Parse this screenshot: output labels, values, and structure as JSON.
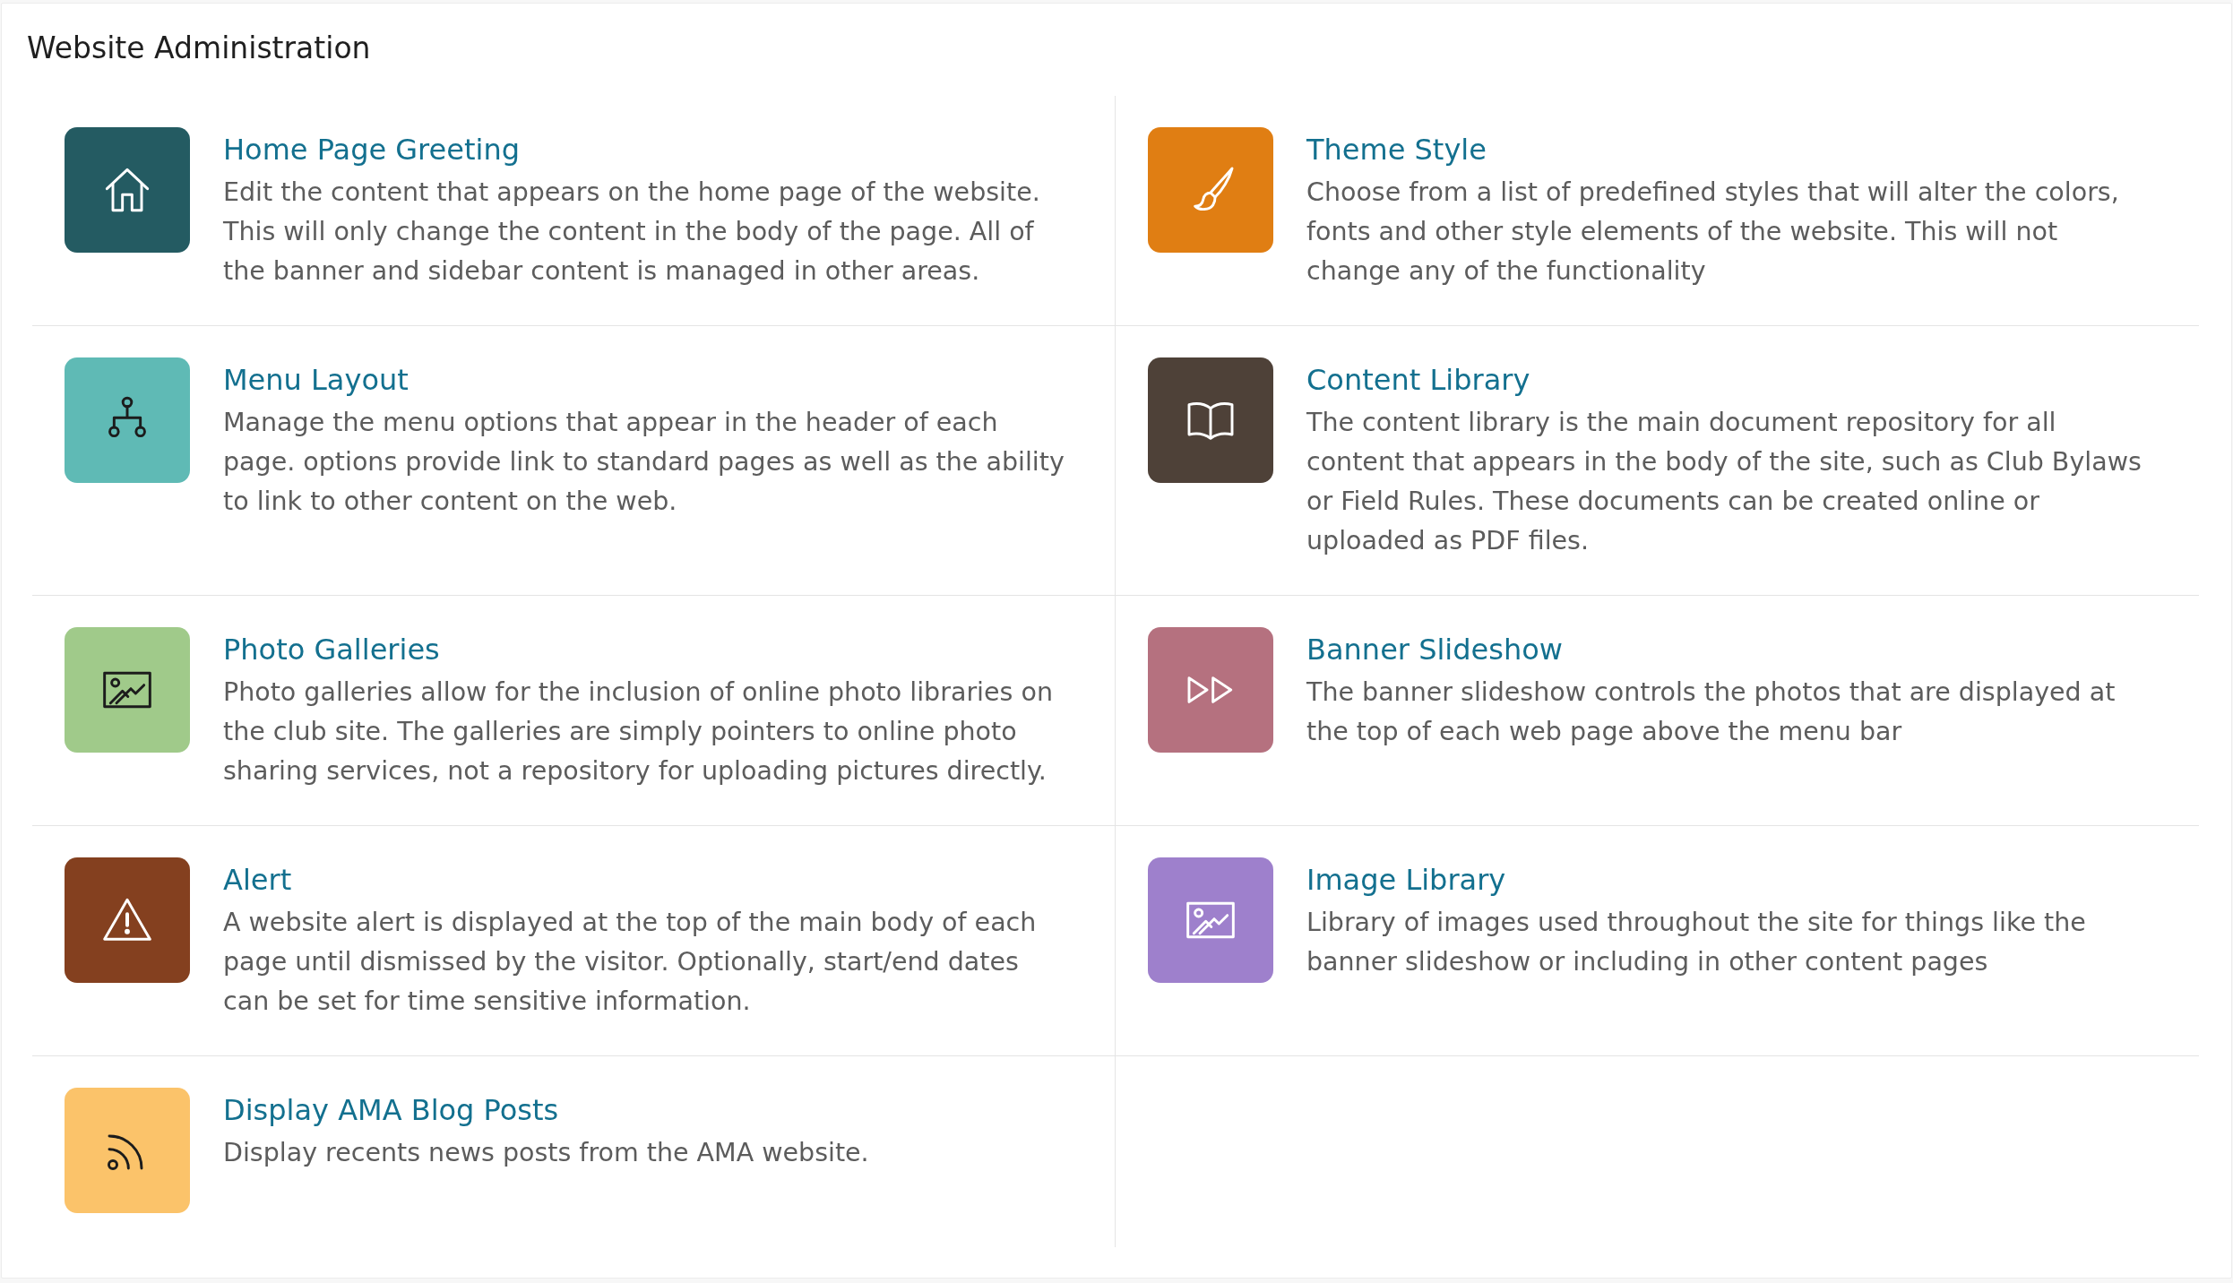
{
  "page": {
    "title": "Website Administration"
  },
  "items": [
    {
      "title": "Home Page Greeting",
      "description": "Edit the content that appears on the home page of the website. This will only change the content in the body of the page. All of the banner and sidebar content is managed in other areas.",
      "color": "#245b62"
    },
    {
      "title": "Theme Style",
      "description": "Choose from a list of predefined styles that will alter the colors, fonts and other style elements of the website. This will not change any of the functionality",
      "color": "#e07e13"
    },
    {
      "title": "Menu Layout",
      "description": "Manage the menu options that appear in the header of each page. options provide link to standard pages as well as the ability to link to other content on the web.",
      "color": "#5fbab5"
    },
    {
      "title": "Content Library",
      "description": "The content library is the main document repository for all content that appears in the body of the site, such as Club Bylaws or Field Rules. These documents can be created online or uploaded as PDF files.",
      "color": "#4e4138"
    },
    {
      "title": "Photo Galleries",
      "description": "Photo galleries allow for the inclusion of online photo libraries on the club site. The galleries are simply pointers to online photo sharing services, not a repository for uploading pictures directly.",
      "color": "#a0ca8a"
    },
    {
      "title": "Banner Slideshow",
      "description": "The banner slideshow controls the photos that are displayed at the top of each web page above the menu bar",
      "color": "#b5717f"
    },
    {
      "title": "Alert",
      "description": "A website alert is displayed at the top of the main body of each page until dismissed by the visitor. Optionally, start/end dates can be set for time sensitive information.",
      "color": "#84401f"
    },
    {
      "title": "Image Library",
      "description": "Library of images used throughout the site for things like the banner slideshow or including in other content pages",
      "color": "#9e80cc"
    },
    {
      "title": "Display AMA Blog Posts",
      "description": "Display recents news posts from the AMA website.",
      "color": "#fbc36a"
    }
  ]
}
